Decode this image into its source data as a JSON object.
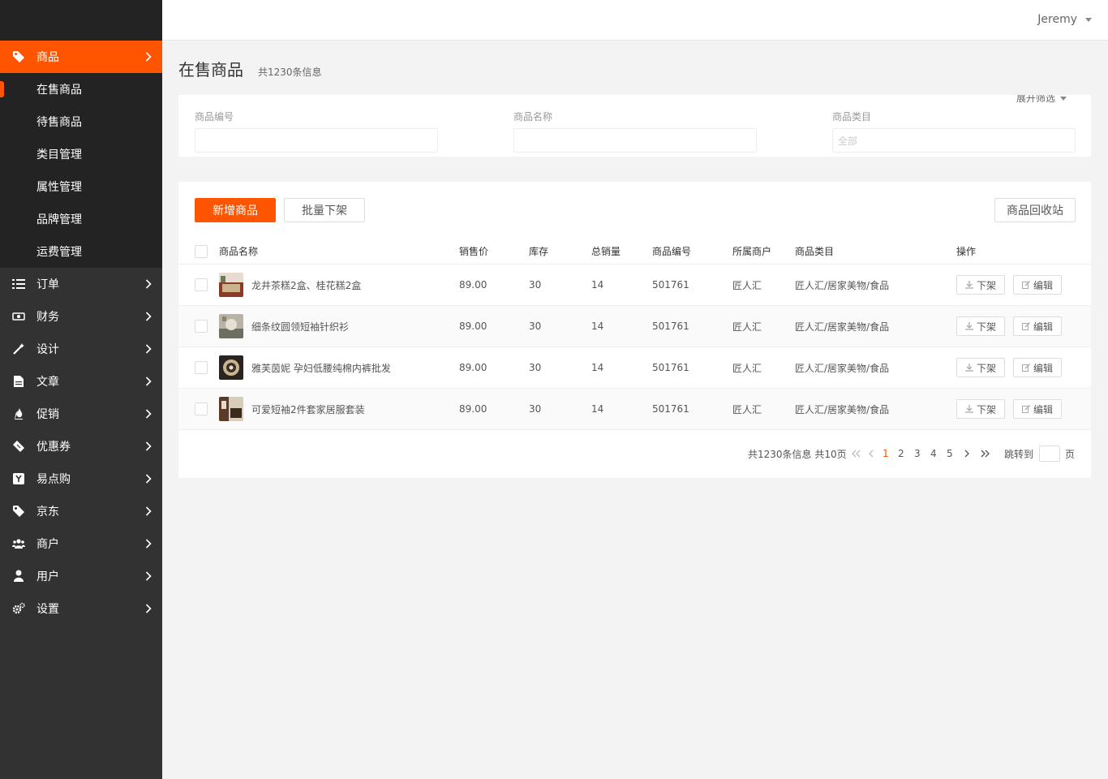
{
  "sidebar": {
    "active_item": {
      "label": "商品",
      "icon": "tag-icon"
    },
    "sub_items": [
      {
        "label": "在售商品"
      },
      {
        "label": "待售商品"
      },
      {
        "label": "类目管理"
      },
      {
        "label": "属性管理"
      },
      {
        "label": "品牌管理"
      },
      {
        "label": "运费管理"
      }
    ],
    "items": [
      {
        "label": "订单",
        "icon": "list-icon"
      },
      {
        "label": "财务",
        "icon": "money-icon"
      },
      {
        "label": "设计",
        "icon": "magic-wand-icon"
      },
      {
        "label": "文章",
        "icon": "document-icon"
      },
      {
        "label": "促销",
        "icon": "flame-icon"
      },
      {
        "label": "优惠券",
        "icon": "ticket-icon"
      },
      {
        "label": "易点购",
        "icon": "y-badge-icon"
      },
      {
        "label": "京东",
        "icon": "tag-icon"
      },
      {
        "label": "商户",
        "icon": "users-icon"
      },
      {
        "label": "用户",
        "icon": "user-icon"
      },
      {
        "label": "设置",
        "icon": "gears-icon"
      }
    ]
  },
  "header": {
    "username": "Jeremy"
  },
  "page": {
    "title": "在售商品",
    "count_text": "共1230条信息"
  },
  "filter": {
    "toggle_label": "展开筛选",
    "fields": [
      {
        "label": "商品编号",
        "value": ""
      },
      {
        "label": "商品名称",
        "value": ""
      },
      {
        "label": "商品类目",
        "value": "全部"
      }
    ]
  },
  "toolbar": {
    "add_label": "新增商品",
    "batch_off_label": "批量下架",
    "recycle_label": "商品回收站"
  },
  "table": {
    "columns": [
      "商品名称",
      "销售价",
      "库存",
      "总销量",
      "商品编号",
      "所属商户",
      "商品类目",
      "操作"
    ],
    "rows": [
      {
        "name": "龙井茶糕2盒、桂花糕2盒",
        "price": "89.00",
        "stock": "30",
        "sales": "14",
        "code": "501761",
        "merchant": "匠人汇",
        "category": "匠人汇/居家美物/食品"
      },
      {
        "name": "细条纹圆领短袖针织衫",
        "price": "89.00",
        "stock": "30",
        "sales": "14",
        "code": "501761",
        "merchant": "匠人汇",
        "category": "匠人汇/居家美物/食品"
      },
      {
        "name": "雅芙茵妮 孕妇低腰纯棉内裤批发",
        "price": "89.00",
        "stock": "30",
        "sales": "14",
        "code": "501761",
        "merchant": "匠人汇",
        "category": "匠人汇/居家美物/食品"
      },
      {
        "name": "可爱短袖2件套家居服套装",
        "price": "89.00",
        "stock": "30",
        "sales": "14",
        "code": "501761",
        "merchant": "匠人汇",
        "category": "匠人汇/居家美物/食品"
      }
    ],
    "action_off": "下架",
    "action_edit": "编辑"
  },
  "pagination": {
    "summary": "共1230条信息 共10页",
    "pages": [
      "1",
      "2",
      "3",
      "4",
      "5"
    ],
    "current": "1",
    "jump_label": "跳转到",
    "page_unit": "页"
  },
  "colors": {
    "accent": "#ff5500",
    "sidebar_bg": "#323232",
    "sidebar_dark": "#232323"
  }
}
